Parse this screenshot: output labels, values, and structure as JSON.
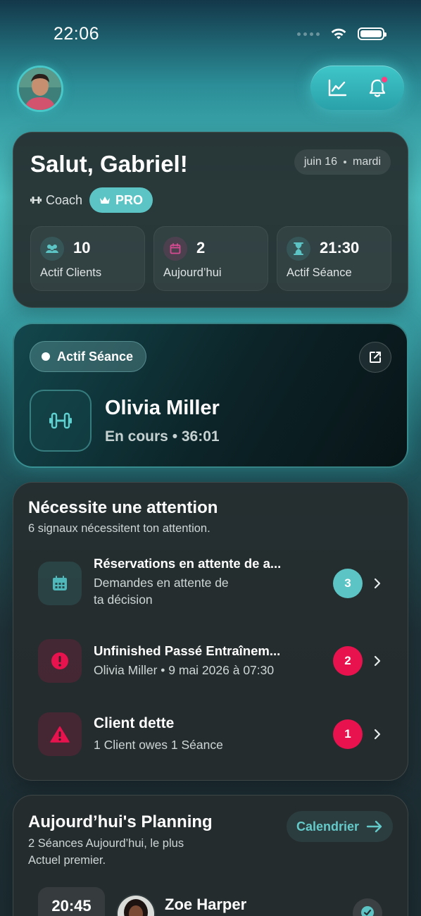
{
  "status_bar": {
    "time": "22:06"
  },
  "greeting": {
    "title": "Salut, Gabriel!",
    "date_day": "juin 16",
    "date_weekday": "mardi",
    "role": "Coach",
    "badge": "PRO"
  },
  "stats": [
    {
      "value": "10",
      "label": "Actif Clients",
      "icon": "users-icon"
    },
    {
      "value": "2",
      "label": "Aujourd’hui",
      "icon": "calendar-icon"
    },
    {
      "value": "21:30",
      "label": "Actif Séance",
      "icon": "hourglass-icon"
    }
  ],
  "active_session": {
    "badge": "Actif Séance",
    "client": "Olivia Miller",
    "status": "En cours • 36:01"
  },
  "attention": {
    "title": "Nécessite une attention",
    "subtitle": "6 signaux nécessitent ton attention.",
    "items": [
      {
        "title": "Réservations en attente de a...",
        "line1": "Demandes en attente de",
        "line2": "ta décision",
        "count": "3"
      },
      {
        "title": "Unfinished Passé Entraînem...",
        "line1": "Olivia Miller • 9 mai 2026 à 07:30",
        "count": "2"
      },
      {
        "title": "Client dette",
        "line1": "1 Client owes 1 Séance",
        "count": "1"
      }
    ]
  },
  "planning": {
    "title": "Aujourd’hui's Planning",
    "line1": "2 Séances Aujourd’hui, le plus",
    "line2": "Actuel premier.",
    "calendar_button": "Calendrier",
    "first": {
      "time": "20:45",
      "client": "Zoe Harper"
    }
  },
  "colors": {
    "accent": "#4fc3c3",
    "danger": "#e8134e",
    "card": "#262c2e"
  }
}
